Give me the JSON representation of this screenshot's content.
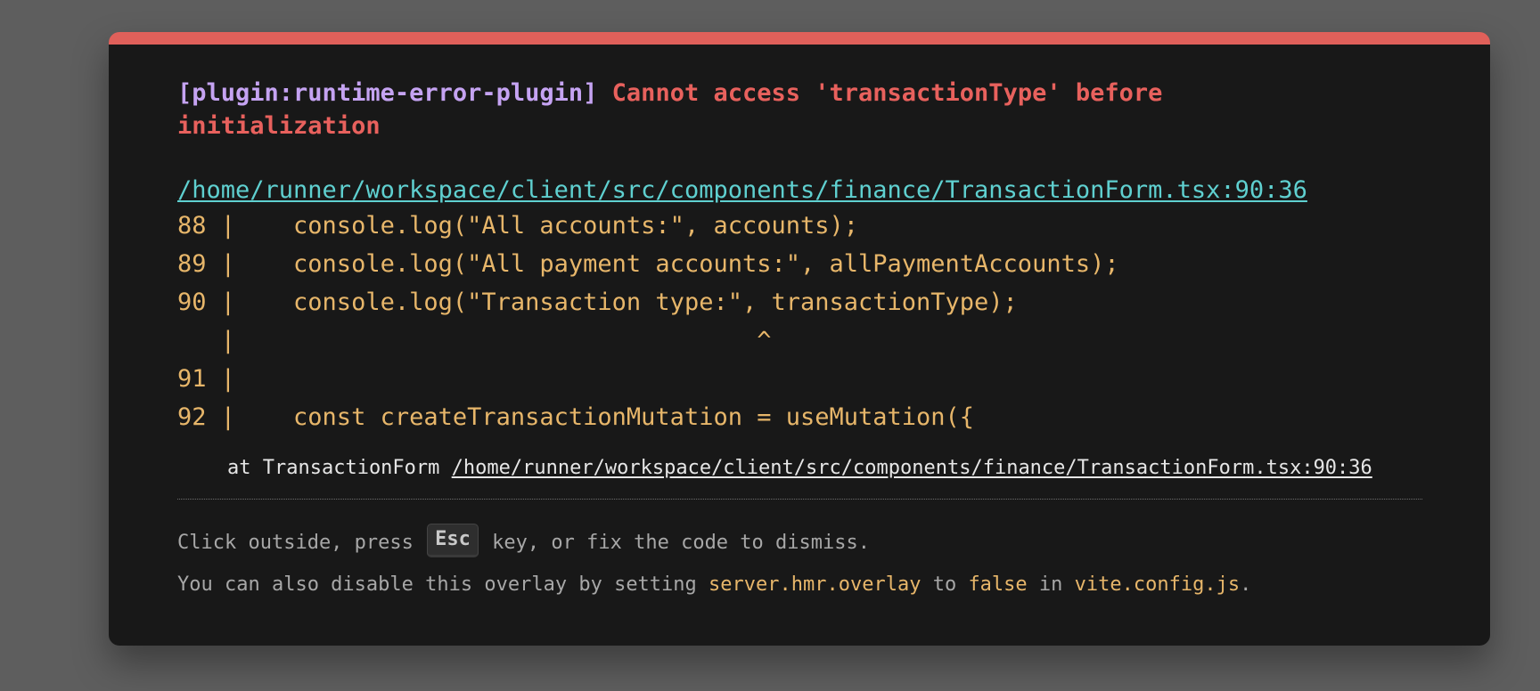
{
  "overlay": {
    "plugin_tag": "[plugin:runtime-error-plugin]",
    "message": "Cannot access 'transactionType' before initialization",
    "file_link": "/home/runner/workspace/client/src/components/finance/TransactionForm.tsx:90:36",
    "frame_lines": [
      "88 |    console.log(\"All accounts:\", accounts);",
      "89 |    console.log(\"All payment accounts:\", allPaymentAccounts);",
      "90 |    console.log(\"Transaction type:\", transactionType);",
      "   |                                    ^",
      "91 |",
      "92 |    const createTransactionMutation = useMutation({"
    ],
    "stack": {
      "prefix": "at TransactionForm ",
      "location": "/home/runner/workspace/client/src/components/finance/TransactionForm.tsx:90:36"
    },
    "tip": {
      "line1_before": "Click outside, press ",
      "key": "Esc",
      "line1_after": " key, or fix the code to dismiss.",
      "line2_a": "You can also disable this overlay by setting ",
      "line2_setting": "server.hmr.overlay",
      "line2_b": " to ",
      "line2_value": "false",
      "line2_c": " in ",
      "line2_file": "vite.config.js",
      "line2_d": "."
    }
  },
  "colors": {
    "accent_bar": "#e0605a",
    "error_text": "#e8615d",
    "plugin_text": "#c5a3f2",
    "link_text": "#5fd0d0",
    "code_text": "#e7b66a",
    "background": "#181818"
  }
}
